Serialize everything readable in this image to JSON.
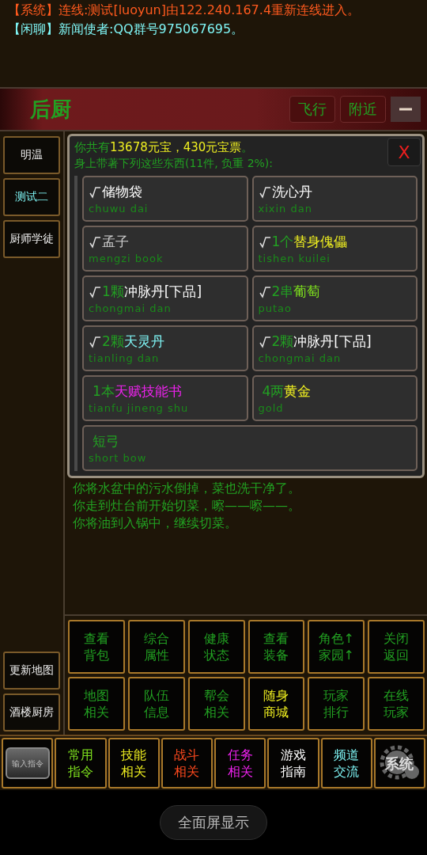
{
  "chat": [
    {
      "channel": "【系统】",
      "text": "连线:测试[luoyun]由122.240.167.4重新连线进入。",
      "color": "#ff5a1e"
    },
    {
      "channel": "【闲聊】",
      "text": "新闻使者:QQ群号975067695。",
      "color": "#7ff5f5"
    }
  ],
  "header": {
    "title": "后厨",
    "buttons": [
      "飞行",
      "附近"
    ]
  },
  "side_top": [
    "明温",
    "测试二",
    "厨师学徒"
  ],
  "side_bottom": [
    "更新地图",
    "酒楼厨房"
  ],
  "inventory": {
    "close": "X",
    "summary": [
      {
        "text": "你共有",
        "color": "#22a022"
      },
      {
        "text": "13678元宝，430元宝票",
        "color": "#f0f020"
      },
      {
        "text": "。",
        "color": "#22a022"
      }
    ],
    "subtitle": "身上带著下列这些东西(11件, 负重 2%):",
    "items": [
      {
        "checked": true,
        "name": "储物袋",
        "color": "#ffffff",
        "pinyin": "chuwu dai",
        "wide": false
      },
      {
        "checked": true,
        "name": "洗心丹",
        "color": "#ffffff",
        "pinyin": "xixin dan",
        "wide": false
      },
      {
        "checked": true,
        "name": "孟子",
        "color": "#cfcfcf",
        "pinyin": "mengzi book",
        "wide": false
      },
      {
        "checked": true,
        "count": "1个",
        "name": "替身傀儡",
        "color": "#f0f020",
        "pinyin": "tishen kuilei",
        "wide": false
      },
      {
        "checked": true,
        "count": "1颗",
        "name": "冲脉丹[下品]",
        "color": "#ffffff",
        "pinyin": "chongmai dan",
        "wide": false
      },
      {
        "checked": true,
        "count": "2串",
        "name": "葡萄",
        "color": "#7ee01e",
        "pinyin": "putao",
        "wide": false
      },
      {
        "checked": true,
        "count": "2颗",
        "name": "天灵丹",
        "color": "#7ff5f5",
        "pinyin": "tianling dan",
        "wide": false
      },
      {
        "checked": true,
        "count": "2颗",
        "name": "冲脉丹[下品]",
        "color": "#ffffff",
        "pinyin": "chongmai dan",
        "wide": false
      },
      {
        "checked": false,
        "count": "1本",
        "name": "天赋技能书",
        "color": "#ee22ee",
        "pinyin": "tianfu jineng shu",
        "wide": false
      },
      {
        "checked": false,
        "count": "4两",
        "name": "黄金",
        "color": "#f0f020",
        "pinyin": "gold",
        "wide": false
      },
      {
        "checked": false,
        "name": "短弓",
        "color": "#22a022",
        "pinyin": "short bow",
        "wide": true
      }
    ]
  },
  "log": [
    "你将水盆中的污水倒掉，菜也洗干净了。",
    "你走到灶台前开始切菜，嚓——嚓——。",
    "你将油到入锅中，继续切菜。"
  ],
  "actions": [
    {
      "lines": [
        "查看",
        "背包"
      ],
      "color": "#22a022"
    },
    {
      "lines": [
        "综合",
        "属性"
      ],
      "color": "#22a022"
    },
    {
      "lines": [
        "健康",
        "状态"
      ],
      "color": "#22a022"
    },
    {
      "lines": [
        "查看",
        "装备"
      ],
      "color": "#22a022"
    },
    {
      "lines": [
        "角色↑",
        "家园↑"
      ],
      "color": "#22a022"
    },
    {
      "lines": [
        "关闭",
        "返回"
      ],
      "color": "#22a022"
    },
    {
      "lines": [
        "地图",
        "相关"
      ],
      "color": "#22a022"
    },
    {
      "lines": [
        "队伍",
        "信息"
      ],
      "color": "#22a022"
    },
    {
      "lines": [
        "帮会",
        "相关"
      ],
      "color": "#22a022"
    },
    {
      "lines": [
        "随身",
        "商城"
      ],
      "color": "#f0f020"
    },
    {
      "lines": [
        "玩家",
        "排行"
      ],
      "color": "#22a022"
    },
    {
      "lines": [
        "在线",
        "玩家"
      ],
      "color": "#22a022"
    }
  ],
  "bottom": [
    {
      "kind": "input",
      "lines": [
        "输入指令"
      ]
    },
    {
      "kind": "text",
      "lines": [
        "常用",
        "指令"
      ],
      "color": "#7ee01e"
    },
    {
      "kind": "text",
      "lines": [
        "技能",
        "相关"
      ],
      "color": "#f0f020"
    },
    {
      "kind": "text",
      "lines": [
        "战斗",
        "相关"
      ],
      "color": "#ff4a1e"
    },
    {
      "kind": "text",
      "lines": [
        "任务",
        "相关"
      ],
      "color": "#ee22ee"
    },
    {
      "kind": "text",
      "lines": [
        "游戏",
        "指南"
      ],
      "color": "#ffffff"
    },
    {
      "kind": "text",
      "lines": [
        "频道",
        "交流"
      ],
      "color": "#7ff5f5"
    },
    {
      "kind": "gear",
      "lines": [
        "系统"
      ],
      "color": "#dddddd"
    }
  ],
  "fullscreen": "全面屏显示"
}
